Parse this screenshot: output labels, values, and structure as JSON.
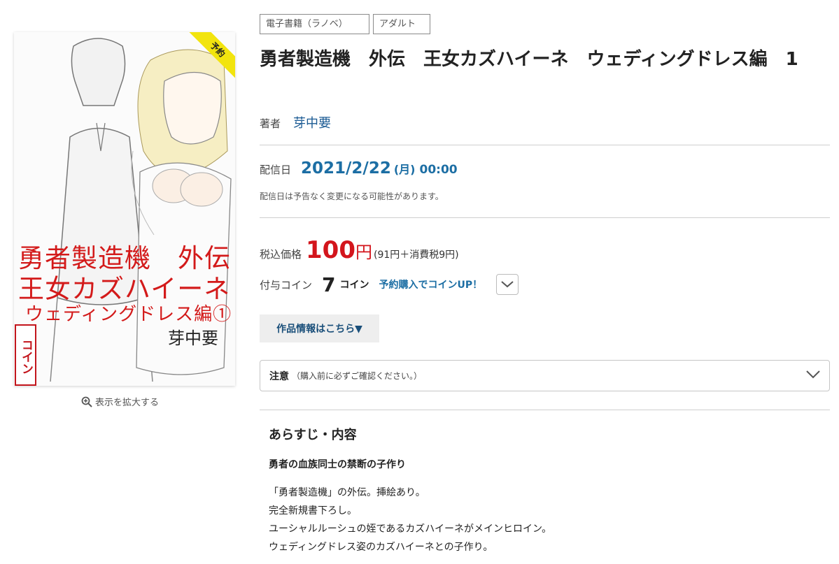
{
  "cover": {
    "title_lines": [
      "勇者製造機　外伝",
      "王女カズハイーネ",
      "ウェディングドレス編①"
    ],
    "author": "芽中要",
    "coin_stamp": "コイン",
    "ribbon": "予約"
  },
  "zoom_label": "表示を拡大する",
  "tags": [
    "電子書籍（ラノベ）",
    "アダルト"
  ],
  "title": "勇者製造機　外伝　王女カズハイーネ　ウェディングドレス編　1",
  "author": {
    "label": "著者",
    "name": "芽中要"
  },
  "release": {
    "label": "配信日",
    "date": "2021/2/22",
    "weekday": "(月)",
    "time": "00:00",
    "note": "配信日は予告なく変更になる可能性があります。"
  },
  "price": {
    "label": "税込価格",
    "amount": "100",
    "currency": "円",
    "breakdown": "(91円＋消費税9円)"
  },
  "coin": {
    "label": "付与コイン",
    "amount": "7",
    "unit": "コイン",
    "promo": "予約購入でコインUP！"
  },
  "info_button": "作品情報はこちら▼",
  "caution": {
    "label": "注意",
    "sub": "（購入前に必ずご確認ください。）"
  },
  "synopsis": {
    "heading": "あらすじ・内容",
    "catch": "勇者の血族同士の禁断の子作り",
    "lines": [
      "「勇者製造機」の外伝。挿絵あり。",
      "完全新規書下ろし。",
      "ユーシャルルーシュの姪であるカズハイーネがメインヒロイン。",
      "ウェディングドレス姿のカズハイーネとの子作り。"
    ]
  },
  "colors": {
    "accent_blue": "#1c6ea4",
    "price_red": "#d3151c"
  }
}
